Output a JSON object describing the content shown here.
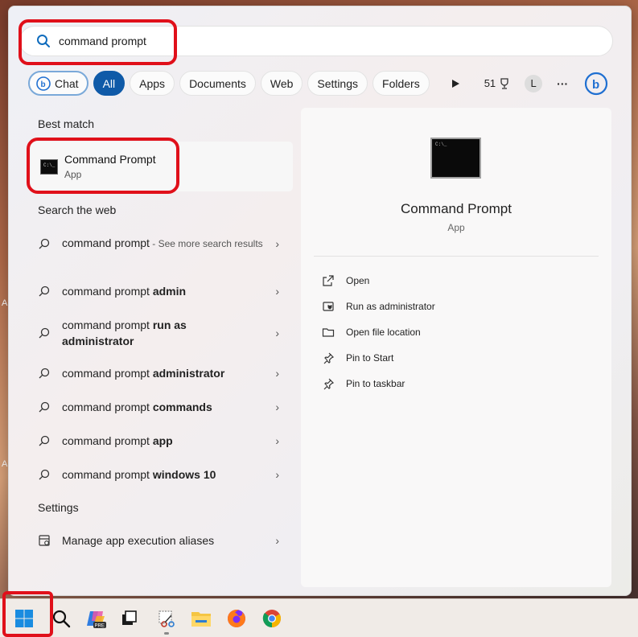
{
  "search": {
    "value": "command prompt",
    "placeholder": ""
  },
  "filters": {
    "chat": "Chat",
    "all": "All",
    "apps": "Apps",
    "documents": "Documents",
    "web": "Web",
    "settings": "Settings",
    "folders": "Folders",
    "points": "51",
    "avatar_initial": "L",
    "more": "···"
  },
  "best_match": {
    "section": "Best match",
    "title": "Command Prompt",
    "subtitle": "App"
  },
  "web": {
    "section": "Search the web",
    "items": [
      {
        "prefix": "command prompt",
        "bold": "",
        "suffix": " - See more search results"
      },
      {
        "prefix": "command prompt ",
        "bold": "admin",
        "suffix": ""
      },
      {
        "prefix": "command prompt ",
        "bold": "run as administrator",
        "suffix": ""
      },
      {
        "prefix": "command prompt ",
        "bold": "administrator",
        "suffix": ""
      },
      {
        "prefix": "command prompt ",
        "bold": "commands",
        "suffix": ""
      },
      {
        "prefix": "command prompt ",
        "bold": "app",
        "suffix": ""
      },
      {
        "prefix": "command prompt ",
        "bold": "windows 10",
        "suffix": ""
      }
    ]
  },
  "settings": {
    "section": "Settings",
    "item": "Manage app execution aliases"
  },
  "detail": {
    "title": "Command Prompt",
    "subtitle": "App",
    "icon_text": "C:\\_",
    "actions": [
      "Open",
      "Run as administrator",
      "Open file location",
      "Pin to Start",
      "Pin to taskbar"
    ]
  },
  "desktop": {
    "edge_letter": "A"
  },
  "taskbar": {
    "copilot_badge": "PRE"
  },
  "colors": {
    "accent": "#0f5aa8",
    "highlight": "#e0101a"
  }
}
